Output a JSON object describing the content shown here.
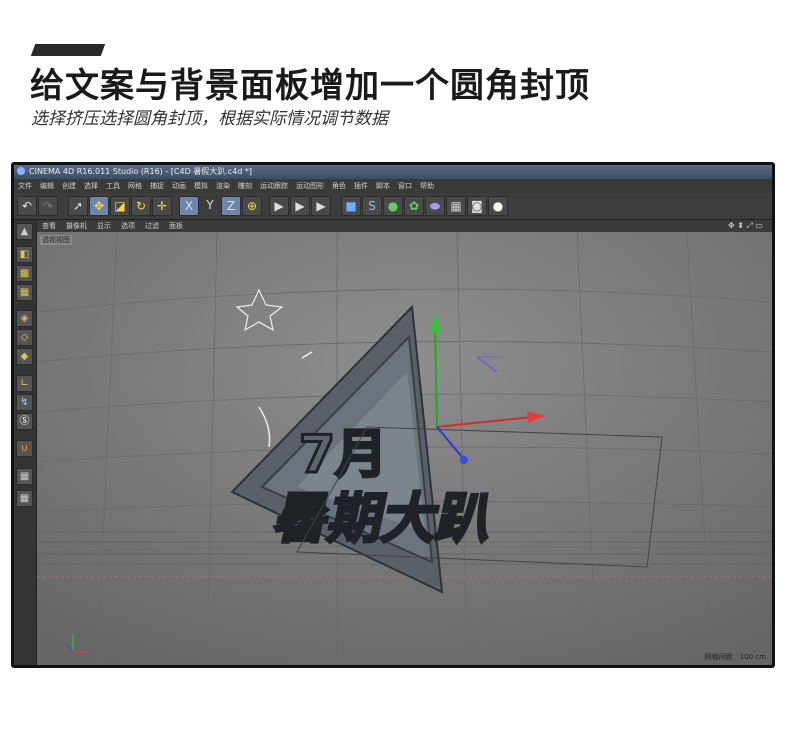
{
  "tutorial": {
    "title": "给文案与背景面板增加一个圆角封顶",
    "subtitle": "选择挤压选择圆角封顶，根据实际情况调节数据"
  },
  "window": {
    "title": "CINEMA 4D R16.011 Studio (R16) - [C4D 暑假大趴.c4d *]"
  },
  "menu": [
    "文件",
    "编辑",
    "创建",
    "选择",
    "工具",
    "网格",
    "捕捉",
    "动画",
    "模拟",
    "渲染",
    "雕刻",
    "运动跟踪",
    "运动图形",
    "角色",
    "插件",
    "脚本",
    "窗口",
    "帮助"
  ],
  "toolbar": {
    "undo_icon": "undo-icon",
    "redo_icon": "redo-icon",
    "x_label": "X",
    "y_label": "Y",
    "z_label": "Z"
  },
  "viewport_menu": [
    "查看",
    "摄像机",
    "显示",
    "选项",
    "过滤",
    "面板"
  ],
  "viewport": {
    "label": "透视视图",
    "grid_readout": "网格间距：100 cm",
    "nav_icons": "✥ ⬍ ⤢ ▭",
    "scene_text_top": "7月",
    "scene_text_bottom": "暑期大趴"
  },
  "colors": {
    "accent": "#6e86a9",
    "viewport_bg": "#7a7a7a"
  }
}
